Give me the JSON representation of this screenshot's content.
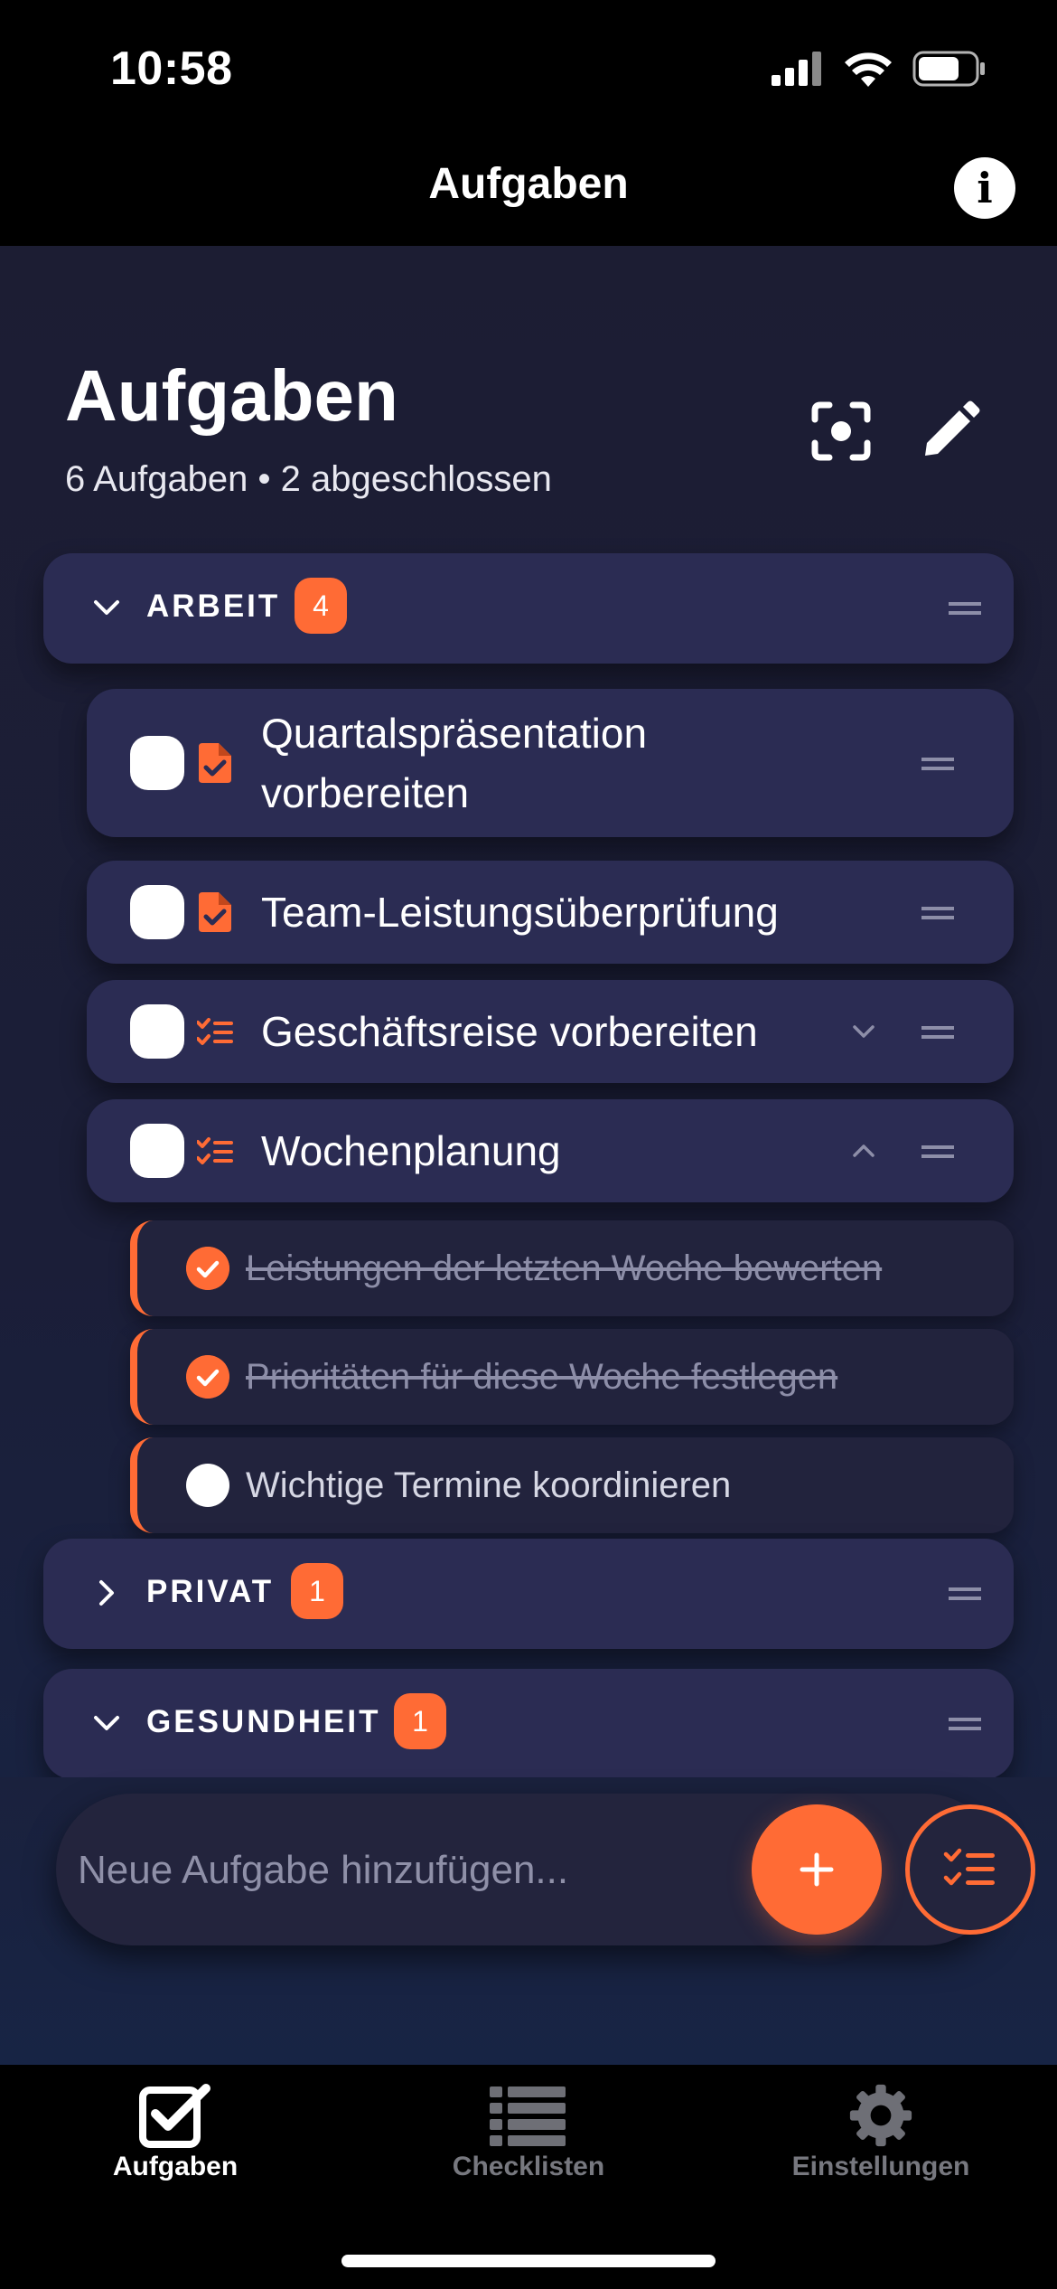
{
  "status": {
    "time": "10:58"
  },
  "nav": {
    "title": "Aufgaben",
    "info_icon": "info-icon"
  },
  "header": {
    "title": "Aufgaben",
    "subtitle": "6 Aufgaben • 2 abgeschlossen"
  },
  "groups": [
    {
      "name": "ARBEIT",
      "count": "4",
      "expanded": true
    },
    {
      "name": "PRIVAT",
      "count": "1",
      "expanded": false
    },
    {
      "name": "GESUNDHEIT",
      "count": "1",
      "expanded": true
    }
  ],
  "tasks": [
    {
      "title_line1": "Quartalspräsentation",
      "title_line2": "vorbereiten",
      "icon": "document-check-icon"
    },
    {
      "title": "Team-Leistungsüberprüfung",
      "icon": "document-check-icon"
    },
    {
      "title": "Geschäftsreise vorbereiten",
      "icon": "checklist-icon",
      "expandable": true,
      "expanded": false
    },
    {
      "title": "Wochenplanung",
      "icon": "checklist-icon",
      "expandable": true,
      "expanded": true
    }
  ],
  "subtasks": [
    {
      "title": "Leistungen der letzten Woche bewerten",
      "done": true
    },
    {
      "title": "Prioritäten für diese Woche festlegen",
      "done": true
    },
    {
      "title": "Wichtige Termine koordinieren",
      "done": false
    }
  ],
  "input": {
    "placeholder": "Neue Aufgabe hinzufügen..."
  },
  "tabs": [
    {
      "label": "Aufgaben",
      "icon": "checkbox-icon",
      "active": true
    },
    {
      "label": "Checklisten",
      "icon": "list-icon",
      "active": false
    },
    {
      "label": "Einstellungen",
      "icon": "gear-icon",
      "active": false
    }
  ],
  "colors": {
    "accent": "#ff6b35",
    "card": "#2b2c53",
    "subcard": "#22233d",
    "background": "#1c1d33"
  }
}
